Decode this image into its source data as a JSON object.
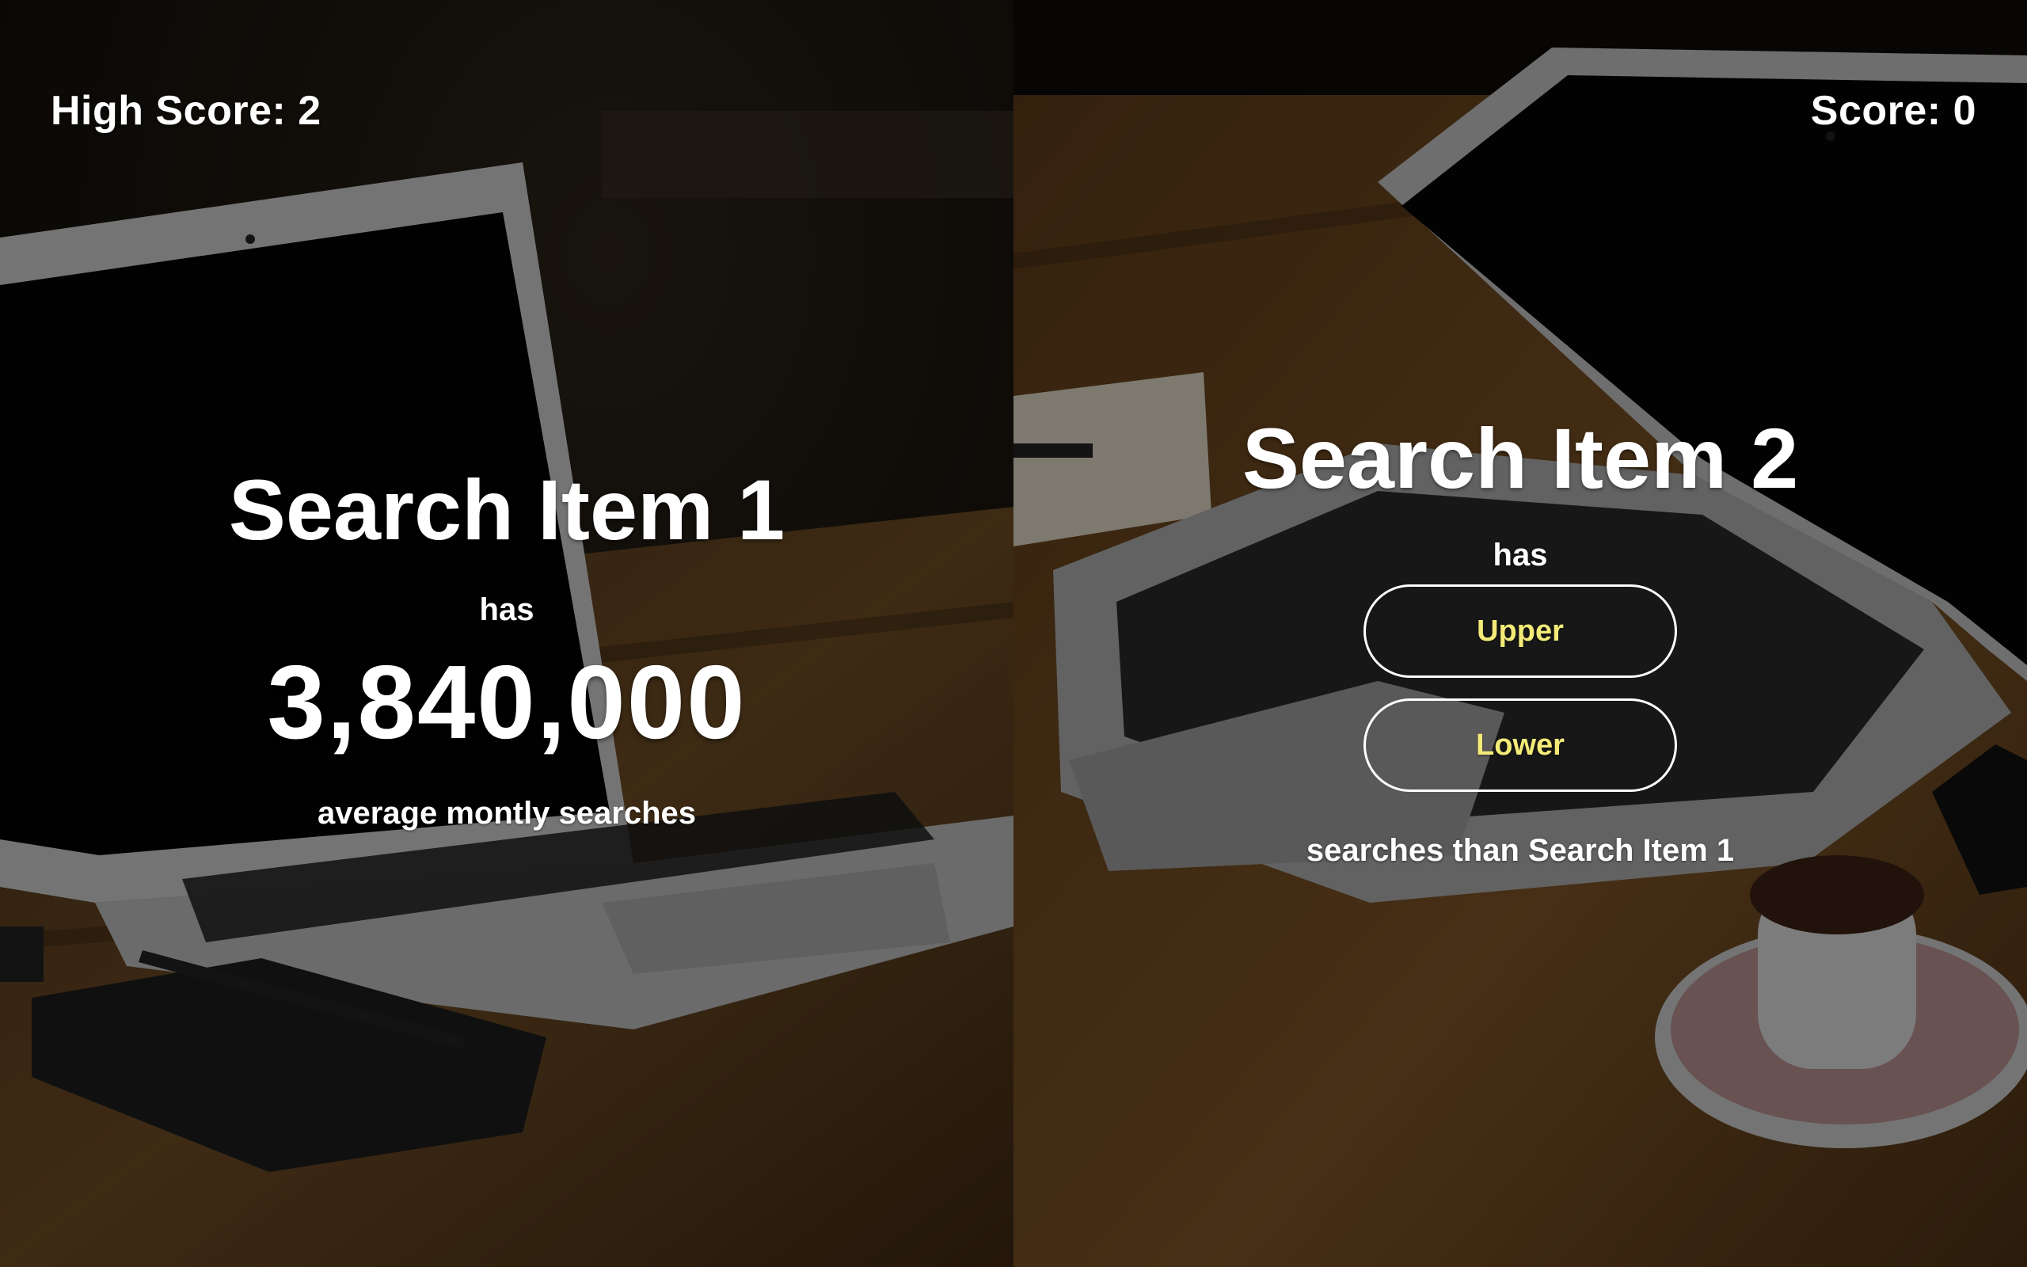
{
  "header": {
    "high_score": "High Score: 2",
    "score": "Score: 0"
  },
  "left_item": {
    "title": "Search Item 1",
    "has": "has",
    "searches": "3,840,000",
    "caption": "average montly searches"
  },
  "right_item": {
    "title": "Search Item 2",
    "has": "has",
    "upper_label": "Upper",
    "lower_label": "Lower",
    "caption": "searches than Search Item 1"
  },
  "colors": {
    "button_text": "#f3ea78",
    "button_border": "#ffffff",
    "text": "#ffffff"
  },
  "icons": {
    "left_background": "laptop-desk-photo",
    "right_background": "laptop-coffee-photo"
  }
}
